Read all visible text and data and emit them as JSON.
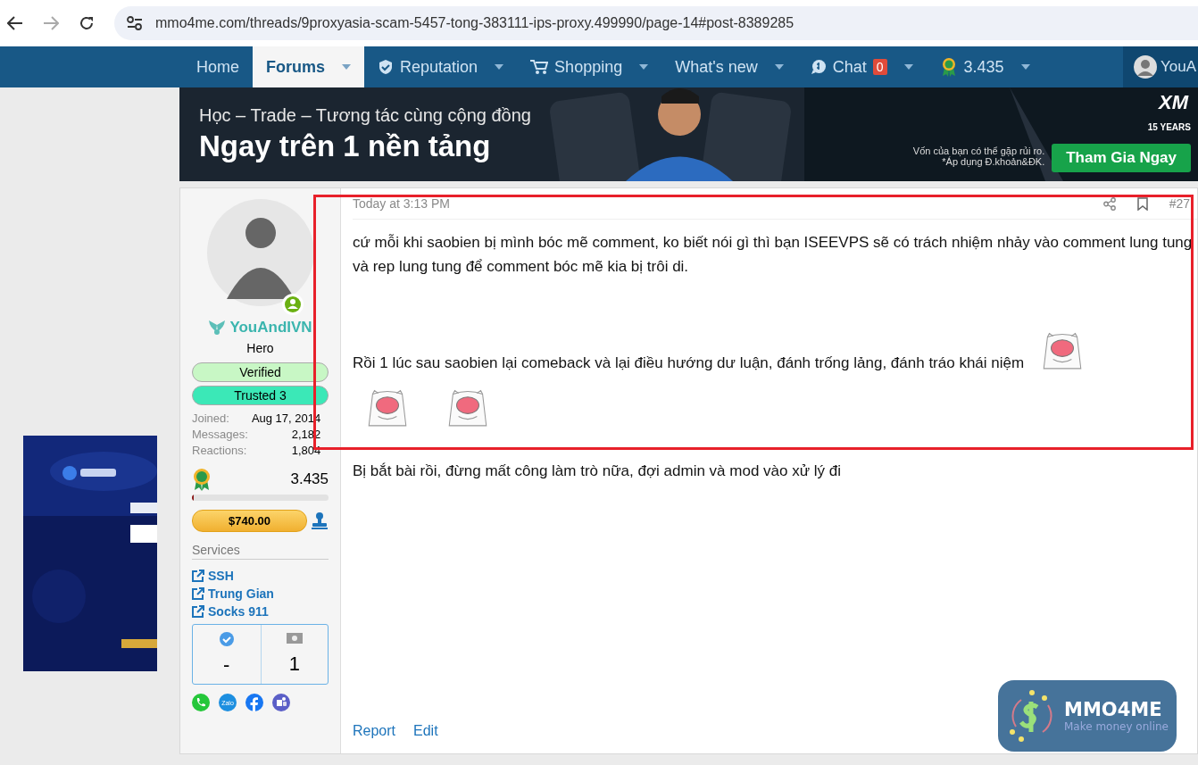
{
  "browser": {
    "url": "mmo4me.com/threads/9proxyasia-scam-5457-tong-383111-ips-proxy.499990/page-14#post-8389285"
  },
  "nav": {
    "items": [
      {
        "label": "Home",
        "kind": "plain",
        "selected": false
      },
      {
        "label": "Forums",
        "kind": "caret",
        "selected": true
      },
      {
        "label": "Reputation",
        "kind": "shield",
        "selected": false
      },
      {
        "label": "Shopping",
        "kind": "cart",
        "selected": false
      },
      {
        "label": "What's new",
        "kind": "caret",
        "selected": false
      },
      {
        "label": "Chat",
        "kind": "chat",
        "selected": false,
        "badge": "0"
      },
      {
        "label": "3.435",
        "kind": "medal",
        "selected": false
      }
    ],
    "user": "YouA"
  },
  "banner": {
    "tagline": "Học – Trade – Tương tác cùng cộng đồng",
    "headline": "Ngay trên 1 nền tảng",
    "brand": "XM",
    "brand_sub": "15 YEARS",
    "disclaimer": "Vốn của bạn có thể gặp rủi ro.",
    "disclaimer_2": "*Áp dụng Đ.khoản&ĐK.",
    "cta": "Tham Gia Ngay"
  },
  "post": {
    "user": {
      "name": "YouAndIVN",
      "title": "Hero",
      "badges": [
        {
          "label": "Verified",
          "color": "#c8f7c5"
        },
        {
          "label": "Trusted 3",
          "color": "#3be8b7"
        }
      ],
      "stats": [
        {
          "label": "Joined:",
          "value": "Aug 17, 2014"
        },
        {
          "label": "Messages:",
          "value": "2,182"
        },
        {
          "label": "Reactions:",
          "value": "1,804"
        }
      ],
      "points": "3.435",
      "level": 0.01,
      "balance": "$740.00",
      "services_heading": "Services",
      "services": [
        {
          "label": "SSH"
        },
        {
          "label": "Trung Gian"
        },
        {
          "label": "Socks 911"
        }
      ],
      "counters": [
        {
          "kind": "verified",
          "value": "-"
        },
        {
          "kind": "money",
          "value": "1"
        }
      ],
      "contacts": [
        {
          "kind": "phone"
        },
        {
          "kind": "zalo",
          "label": "Zalo"
        },
        {
          "kind": "facebook"
        },
        {
          "kind": "teams"
        }
      ]
    },
    "time": "Today at 3:13 PM",
    "number": "#27",
    "blocks": [
      {
        "kind": "text",
        "text": "cứ mỗi khi saobien bị mình bóc mẽ comment, ko biết nói gì thì bạn ISEEVPS sẽ có trách nhiệm nhảy vào comment lung tung và rep lung tung để comment bóc mẽ kia bị trôi di."
      },
      {
        "kind": "text_sticker",
        "text": "Rồi 1 lúc sau saobien lại comeback và lại điều hướng dư luận, đánh trống lảng, đánh tráo khái niệm"
      },
      {
        "kind": "stickers",
        "stickers": [
          {
            "kind": "sticker"
          },
          {
            "kind": "sticker"
          }
        ]
      },
      {
        "kind": "text",
        "text": "Bị bắt bài rồi, đừng mất công làm trò nữa, đợi admin và mod vào xử lý đi"
      }
    ],
    "actions": [
      "Report",
      "Edit"
    ]
  },
  "widget": {
    "title": "MMO4ME",
    "subtitle": "Make money online"
  }
}
